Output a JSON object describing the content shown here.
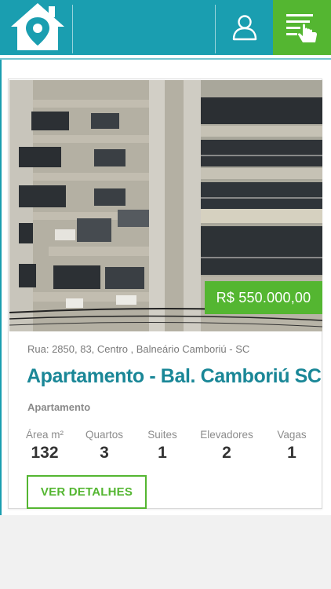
{
  "header": {
    "logo_icon": "house-location-pin-icon",
    "user_icon": "user-profile-icon",
    "menu_icon": "filter-menu-hand-icon",
    "colors": {
      "primary": "#1a9eb0",
      "accent": "#54b631"
    }
  },
  "listing": {
    "price": "R$ 550.000,00",
    "address": "Rua: 2850, 83, Centro  , Balneário Camboriú - SC",
    "title": "Apartamento - Bal. Camboriú SC",
    "type": "Apartamento",
    "stats": [
      {
        "label": "Área m²",
        "value": "132"
      },
      {
        "label": "Quartos",
        "value": "3"
      },
      {
        "label": "Suites",
        "value": "1"
      },
      {
        "label": "Elevadores",
        "value": "2"
      },
      {
        "label": "Vagas",
        "value": "1"
      }
    ],
    "details_label": "VER DETALHES"
  }
}
